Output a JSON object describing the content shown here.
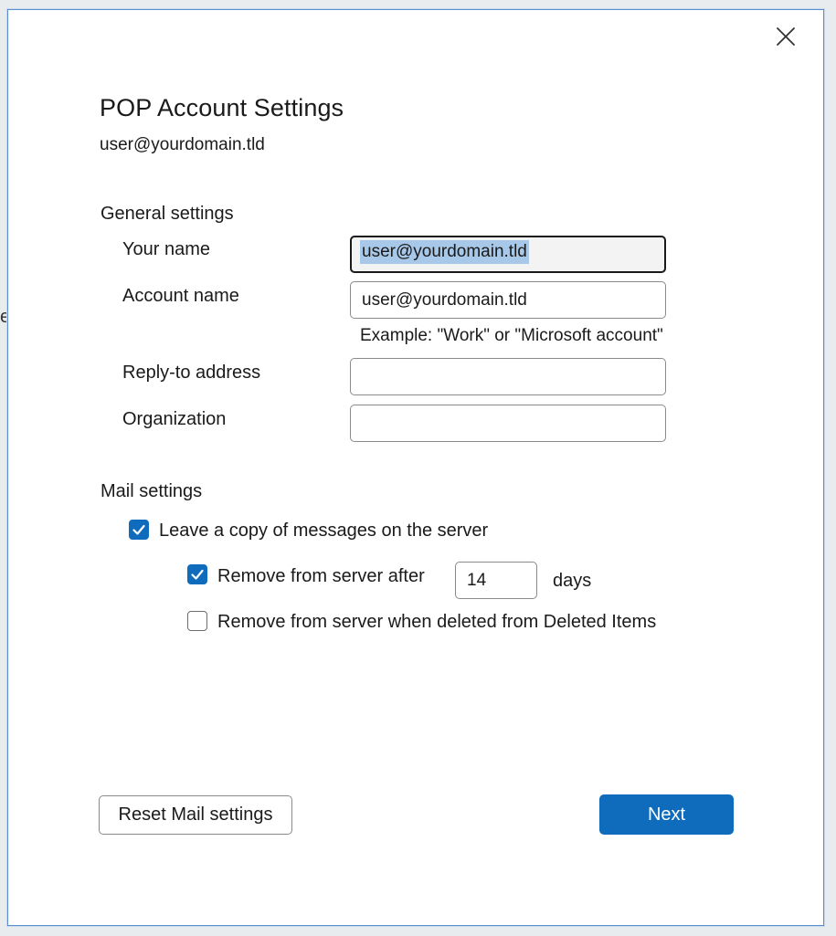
{
  "background": {
    "edge_char": "e"
  },
  "dialog": {
    "title": "POP Account Settings",
    "subtitle": "user@yourdomain.tld",
    "close_icon": "close-icon",
    "general": {
      "heading": "General settings",
      "your_name": {
        "label": "Your name",
        "value": "user@yourdomain.tld",
        "selected": true
      },
      "account_name": {
        "label": "Account name",
        "value": "user@yourdomain.tld",
        "hint": "Example: \"Work\" or \"Microsoft account\""
      },
      "reply_to": {
        "label": "Reply-to address",
        "value": ""
      },
      "organization": {
        "label": "Organization",
        "value": ""
      }
    },
    "mail": {
      "heading": "Mail settings",
      "leave_copy": {
        "label": "Leave a copy of messages on the server",
        "checked": true
      },
      "remove_after": {
        "label": "Remove from server after",
        "checked": true,
        "days_value": "14",
        "days_unit": "days"
      },
      "remove_deleted": {
        "label": "Remove from server when deleted from Deleted Items",
        "checked": false
      }
    },
    "buttons": {
      "reset_label": "Reset Mail settings",
      "next_label": "Next"
    },
    "colors": {
      "accent": "#0f6cbd",
      "selection": "#a8c8ea",
      "border": "#8a8a8a"
    }
  }
}
